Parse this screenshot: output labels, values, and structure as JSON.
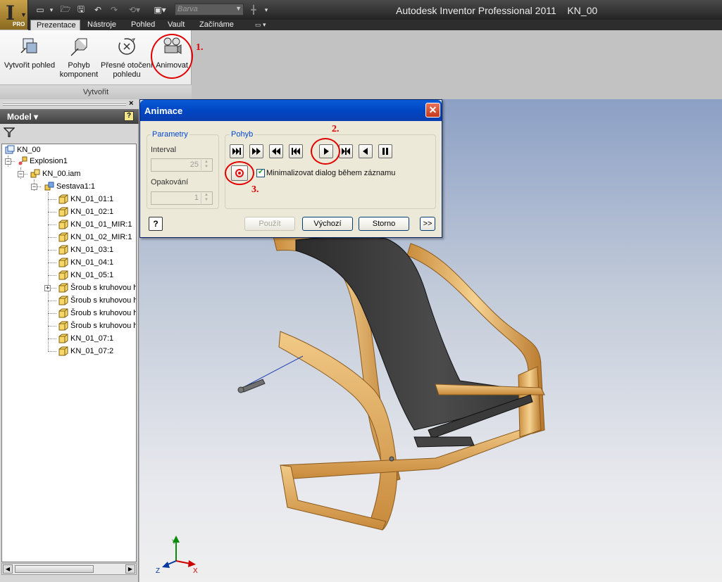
{
  "app": {
    "title": "Autodesk Inventor Professional 2011    KN_00",
    "logo_badge": "PRO",
    "color_combo_placeholder": "Barva"
  },
  "ribbon": {
    "tabs": [
      "Prezentace",
      "Nástroje",
      "Pohled",
      "Vault",
      "Začínáme"
    ],
    "active_tab": "Prezentace",
    "buttons": {
      "create_view": "Vytvořit pohled",
      "tweak_components_1": "Pohyb",
      "tweak_components_2": "komponent",
      "precise_rotate_1": "Přesné otočení",
      "precise_rotate_2": "pohledu",
      "animate": "Animovat"
    },
    "group_label": "Vytvořit"
  },
  "annotations": {
    "step1": "1.",
    "step2": "2.",
    "step3": "3.",
    "color": "#e00000"
  },
  "browser": {
    "title": "Model ▾",
    "help_glyph": "?",
    "close_glyph": "×",
    "tree": {
      "root": "KN_00",
      "explosion": "Explosion1",
      "assembly_file": "KN_00.iam",
      "subassembly": "Sestava1:1",
      "parts": [
        "KN_01_01:1",
        "KN_01_02:1",
        "KN_01_01_MIR:1",
        "KN_01_02_MIR:1",
        "KN_01_03:1",
        "KN_01_04:1",
        "KN_01_05:1",
        "Šroub s kruhovou h",
        "Šroub s kruhovou h",
        "Šroub s kruhovou h",
        "Šroub s kruhovou h",
        "KN_01_07:1",
        "KN_01_07:2"
      ]
    }
  },
  "dialog": {
    "title": "Animace",
    "parameters_group": "Parametry",
    "interval_label": "Interval",
    "interval_value": "25",
    "repetitions_label": "Opakování",
    "repetitions_value": "1",
    "motion_group": "Pohyb",
    "minimize_label": "Minimalizovat dialog během záznamu",
    "minimize_checked": true,
    "buttons": {
      "apply": "Použít",
      "reset": "Výchozí",
      "cancel": "Storno",
      "more": ">>",
      "help": "?"
    }
  },
  "triad": {
    "x_label": "X",
    "y_label": "Y",
    "z_label": "Z"
  }
}
